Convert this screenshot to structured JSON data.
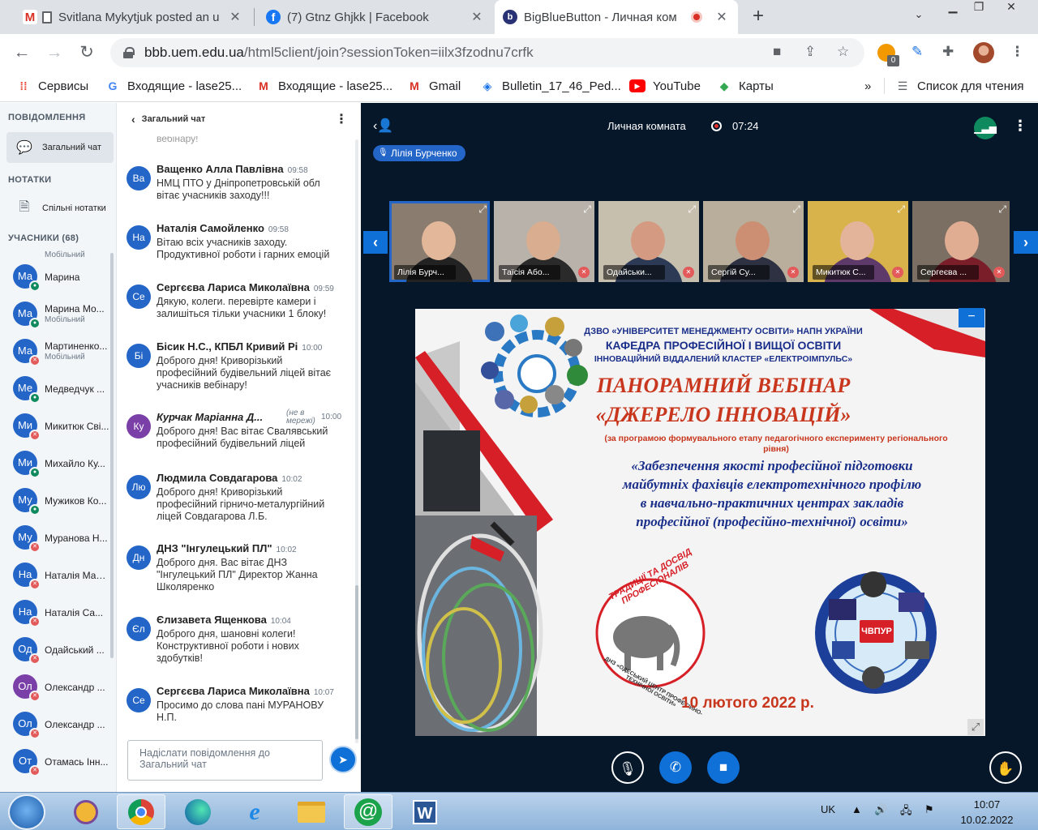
{
  "browser": {
    "tabs": [
      {
        "title": "Svitlana Mykytjuk posted an u",
        "icon": "gmail-icon",
        "active": false
      },
      {
        "title": "(7) Gtnz Ghjkk | Facebook",
        "icon": "facebook-icon",
        "active": false
      },
      {
        "title": "BigBlueButton - Личная ком",
        "icon": "bbb-icon",
        "active": true
      }
    ],
    "new_tab": "+",
    "url_host": "bbb.uem.edu.ua",
    "url_path": "/html5client/join?sessionToken=iilx3fzodnu7crfk",
    "ext_badge": "0",
    "bookmarks": [
      "Сервисы",
      "Входящие - lase25...",
      "Входящие - lase25...",
      "Gmail",
      "Bulletin_17_46_Ped...",
      "YouTube",
      "Карты"
    ],
    "more_bookmarks": "»",
    "reading_list": "Список для чтения"
  },
  "sidebar": {
    "messages_heading": "ПОВІДОМЛЕННЯ",
    "public_chat": "Загальний чат",
    "notes_heading": "НОТАТКИ",
    "shared_notes": "Спільні нотатки",
    "users_heading": "УЧАСНИКИ (68)",
    "users": [
      {
        "initials": "Ма",
        "name": "Марина",
        "sub": "",
        "mic": "on",
        "color": "#2465c8"
      },
      {
        "initials": "Ма",
        "name": "Марина Мо...",
        "sub": "Мобільний",
        "mic": "on",
        "color": "#2465c8"
      },
      {
        "initials": "Ма",
        "name": "Мартиненко...",
        "sub": "Мобільний",
        "mic": "off",
        "color": "#2465c8"
      },
      {
        "initials": "Ме",
        "name": "Медведчук ...",
        "sub": "",
        "mic": "on",
        "color": "#2465c8"
      },
      {
        "initials": "Ми",
        "name": "Микитюк Сві...",
        "sub": "",
        "mic": "off",
        "color": "#2465c8"
      },
      {
        "initials": "Ми",
        "name": "Михайло Ку...",
        "sub": "",
        "mic": "on",
        "color": "#2465c8"
      },
      {
        "initials": "Му",
        "name": "Мужиков Ко...",
        "sub": "",
        "mic": "on",
        "color": "#2465c8"
      },
      {
        "initials": "Му",
        "name": "Муранова Н...",
        "sub": "",
        "mic": "off",
        "color": "#2465c8"
      },
      {
        "initials": "На",
        "name": "Наталія Мар...",
        "sub": "",
        "mic": "off",
        "color": "#2465c8"
      },
      {
        "initials": "На",
        "name": "Наталія Са...",
        "sub": "",
        "mic": "off",
        "color": "#2465c8"
      },
      {
        "initials": "Од",
        "name": "Одайський ...",
        "sub": "",
        "mic": "off",
        "color": "#2465c8"
      },
      {
        "initials": "Ол",
        "name": "Олександр ...",
        "sub": "",
        "mic": "off",
        "color": "#7b3fa8"
      },
      {
        "initials": "Ол",
        "name": "Олександр ...",
        "sub": "",
        "mic": "off",
        "color": "#2465c8"
      },
      {
        "initials": "От",
        "name": "Отамась Інн...",
        "sub": "",
        "mic": "off",
        "color": "#2465c8"
      }
    ],
    "partial_top_sub": "Мобільний"
  },
  "chat": {
    "title": "Загальний чат",
    "partial_top": "вебінару!",
    "messages": [
      {
        "initials": "Ва",
        "name": "Ващенко Алла Павлівна",
        "time": "09:58",
        "text": "НМЦ ПТО у Дніпропетровській обл вітає учасників заходу!!!",
        "color": "#2465c8",
        "offline": ""
      },
      {
        "initials": "На",
        "name": "Наталія Самойленко",
        "time": "09:58",
        "text": "Вітаю всіх учасників заходу. Продуктивної роботи і гарних емоцій",
        "color": "#2465c8",
        "offline": ""
      },
      {
        "initials": "Се",
        "name": "Сергєєва Лариса Миколаївна",
        "time": "09:59",
        "text": "Дякую, колеги. перевірте камери і залишіться тільки учасники 1 блоку!",
        "color": "#2465c8",
        "offline": ""
      },
      {
        "initials": "Бі",
        "name": "Бісик Н.С., КПБЛ Кривий Рі",
        "time": "10:00",
        "text": "Доброго дня! Криворізький професійний будівельний ліцей вітає учасників вебінару!",
        "color": "#2465c8",
        "offline": ""
      },
      {
        "initials": "Ку",
        "name": "Курчак Маріанна Д...",
        "time": "10:00",
        "text": "Доброго дня! Вас вітає Свалявський професійний будівельний ліцей",
        "color": "#7b3fa8",
        "offline": "(не в мережі)"
      },
      {
        "initials": "Лю",
        "name": "Людмила Совдагарова",
        "time": "10:02",
        "text": "Доброго дня! Криворізький професійний гірничо-металургійний ліцей Совдагарова Л.Б.",
        "color": "#2465c8",
        "offline": ""
      },
      {
        "initials": "Дн",
        "name": "ДНЗ \"Інгулецький ПЛ\"",
        "time": "10:02",
        "text": "Доброго дня. Вас вітає ДНЗ \"Інгулецький ПЛ\" Директор Жанна Школяренко",
        "color": "#2465c8",
        "offline": ""
      },
      {
        "initials": "Єл",
        "name": "Єлизавета Ященкова",
        "time": "10:04",
        "text": "Доброго дня, шановні колеги! Конструктивної роботи і нових здобутків!",
        "color": "#2465c8",
        "offline": ""
      },
      {
        "initials": "Се",
        "name": "Сергєєва Лариса Миколаївна",
        "time": "10:07",
        "text": "Просимо до слова пані МУРАНОВУ Н.П.",
        "color": "#2465c8",
        "offline": ""
      }
    ],
    "input_placeholder": "Надіслати повідомлення до Загальний чат"
  },
  "meeting": {
    "room_title": "Личная комната",
    "rec_time": "07:24",
    "talker": "Лілія Бурченко",
    "videos": [
      {
        "label": "Лілія Бурч...",
        "muted": false,
        "bg": "#8a7c6f",
        "skin": "#e2b79a",
        "shirt": "#222"
      },
      {
        "label": "Таїсія Або...",
        "muted": true,
        "bg": "#b8b2aa",
        "skin": "#d9ad8f",
        "shirt": "#2a2a2a"
      },
      {
        "label": "Одайськи...",
        "muted": true,
        "bg": "#c7bfae",
        "skin": "#d49b82",
        "shirt": "#2c3a55"
      },
      {
        "label": "Сергій Су...",
        "muted": true,
        "bg": "#b8ae9b",
        "skin": "#cc8f73",
        "shirt": "#2d3142"
      },
      {
        "label": "Микитюк С...",
        "muted": true,
        "bg": "#d8b24a",
        "skin": "#e4b49a",
        "shirt": "#5d3a6a"
      },
      {
        "label": "Сергеєва ...",
        "muted": true,
        "bg": "#7a6f62",
        "skin": "#e0ad93",
        "shirt": "#7a1f2a"
      }
    ],
    "slide": {
      "org1": "ДЗВО «УНІВЕРСИТЕТ МЕНЕДЖМЕНТУ ОСВІТИ»  НАПН УКРАЇНИ",
      "org2": "КАФЕДРА ПРОФЕСІЙНОЇ І ВИЩОЇ ОСВІТИ",
      "org3": "ІННОВАЦІЙНИЙ ВІДДАЛЕНИЙ КЛАСТЕР  «ЕЛЕКТРОІМПУЛЬС»",
      "title1": "ПАНОРАМНИЙ ВЕБІНАР",
      "title2": "«ДЖЕРЕЛО ІННОВАЦІЙ»",
      "subtitle": "(за програмою формувального етапу  педагогічного експерименту регіонального рівня)",
      "theme1": "«Забезпечення якості професійної підготовки",
      "theme2": "майбутніх фахівців електротехнічного профілю",
      "theme3": "в навчально-практичних  центрах закладів",
      "theme4": "професійної  (професійно-технічної)  освіти»",
      "seal_text": "ТРАДИЦІЇ ТА ДОСВІД ПРОФЕСІОНАЛІВ",
      "seal_org": "ДНЗ «ОДЕСЬКИЙ ЦЕНТР ПРОФЕСІЙНО-ТЕХНІЧНОЇ ОСВІТИ»",
      "emblem_text": "ЧВПУР",
      "date": "10 лютого 2022 р."
    }
  },
  "taskbar": {
    "lang": "UK",
    "time": "10:07",
    "date": "10.02.2022"
  }
}
